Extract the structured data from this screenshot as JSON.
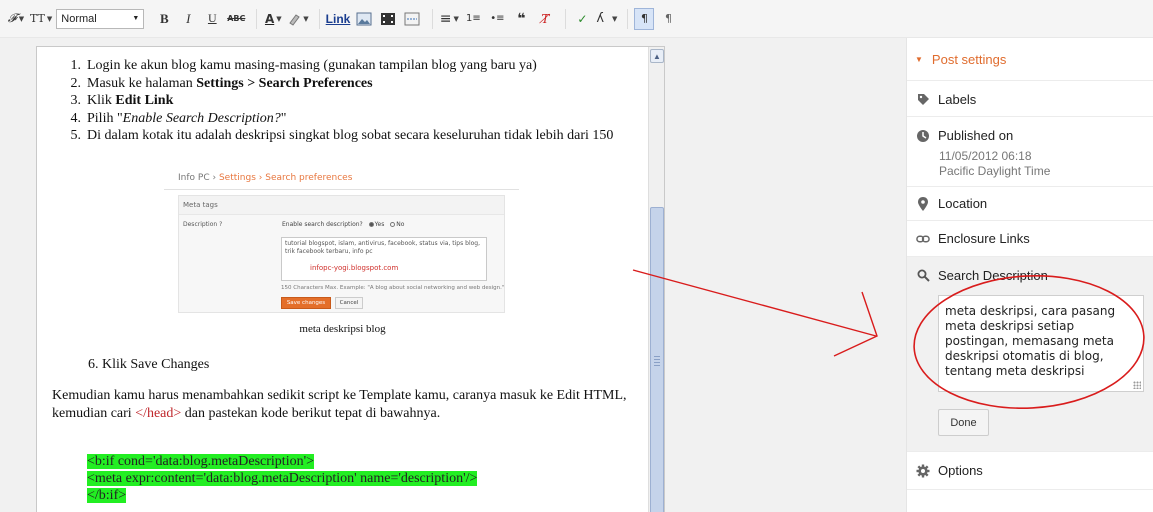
{
  "toolbar": {
    "font_family_glyph": "𝓕",
    "font_size_glyph": "TT",
    "format_select": "Normal",
    "bold": "B",
    "italic": "I",
    "underline": "U",
    "strikethrough": "ABC",
    "font_color": "A",
    "link": "Link",
    "align_glyph": "≡",
    "numbered_list_glyph": "1≡",
    "bulleted_list_glyph": "•≡",
    "quote_glyph": "❝",
    "remove_format_glyph": "T̸",
    "spellcheck_glyph": "✓",
    "input_tools_glyph": "ʎ",
    "ltr_glyph": "¶",
    "rtl_glyph": "¶"
  },
  "editor": {
    "steps": [
      {
        "num": "1.",
        "text": "Login ke akun blog kamu masing-masing (gunakan tampilan blog yang baru ya)"
      },
      {
        "num": "2.",
        "pre": "Masuk ke halaman ",
        "bold": "Settings > Search Preferences"
      },
      {
        "num": "3.",
        "pre": "Klik ",
        "bold": "Edit Link"
      },
      {
        "num": "4.",
        "pre": "Pilih \"",
        "italic": "Enable Search Description?",
        "post": "\""
      },
      {
        "num": "5.",
        "text": "Di dalam kotak itu adalah deskripsi singkat blog sobat secara keseluruhan tidak lebih dari 150"
      }
    ],
    "figure": {
      "breadcrumb_root": "Info PC",
      "breadcrumb_settings": "Settings",
      "breadcrumb_page": "Search preferences",
      "sep": "›",
      "meta_tags": "Meta tags",
      "description_label": "Description  ?",
      "enable_label": "Enable search description?",
      "yes": "Yes",
      "no": "No",
      "textarea_text": "tutorial blogspot, islam, antivirus, facebook, status via, tips blog, trik facebook terbaru, info pc",
      "url_text": "infopc-yogi.blogspot.com",
      "chars_text": "150 Characters Max. Example: \"A blog about social networking and web design.\"",
      "save": "Save changes",
      "cancel": "Cancel"
    },
    "caption": "meta deskripsi blog",
    "step6": "6. Klik Save Changes",
    "paragraph_a": "Kemudian kamu harus menambahkan sedikit script ke Template kamu, caranya masuk ke Edit HTML, kemudian cari ",
    "paragraph_tag": "</head>",
    "paragraph_b": " dan pastekan kode berikut tepat di bawahnya.",
    "code": [
      "<b:if cond='data:blog.metaDescription'>",
      "<meta expr:content='data:blog.metaDescription' name='description'/>",
      "</b:if>"
    ]
  },
  "panel": {
    "post_settings": "Post settings",
    "labels": "Labels",
    "published_on": "Published on",
    "published_date": "11/05/2012 06:18",
    "published_tz": "Pacific Daylight Time",
    "location": "Location",
    "enclosure_links": "Enclosure Links",
    "search_description": "Search Description",
    "description_value": "meta deskripsi, cara pasang meta deskripsi setiap postingan, memasang meta deskripsi otomatis di blog, tentang meta deskripsi",
    "done": "Done",
    "options": "Options"
  },
  "colors": {
    "accent_orange": "#e06c2e",
    "annotation_red": "#d91c1c",
    "code_highlight": "#22ee22",
    "tag_red": "#c0282d"
  },
  "icons": [
    "label-icon",
    "clock-icon",
    "location-pin-icon",
    "link-icon",
    "search-icon",
    "gear-icon"
  ]
}
